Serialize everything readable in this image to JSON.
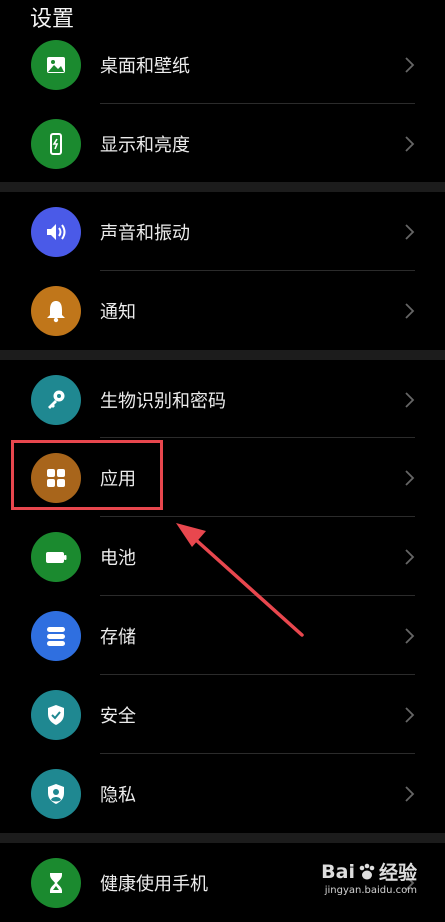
{
  "header": {
    "title": "设置"
  },
  "settings": {
    "items": [
      {
        "label": "桌面和壁纸",
        "icon": "wallpaper-icon",
        "color": "#1b8a2f"
      },
      {
        "label": "显示和亮度",
        "icon": "display-icon",
        "color": "#1b8a2f"
      },
      {
        "label": "声音和振动",
        "icon": "speaker-icon",
        "color": "#4a5ae8"
      },
      {
        "label": "通知",
        "icon": "bell-icon",
        "color": "#c0761a"
      },
      {
        "label": "生物识别和密码",
        "icon": "key-icon",
        "color": "#1f8891"
      },
      {
        "label": "应用",
        "icon": "apps-grid-icon",
        "color": "#a8651b"
      },
      {
        "label": "电池",
        "icon": "battery-icon",
        "color": "#1b8a2f"
      },
      {
        "label": "存储",
        "icon": "storage-icon",
        "color": "#2f6fe0"
      },
      {
        "label": "安全",
        "icon": "shield-check-icon",
        "color": "#1f8891"
      },
      {
        "label": "隐私",
        "icon": "privacy-icon",
        "color": "#1f8891"
      },
      {
        "label": "健康使用手机",
        "icon": "hourglass-icon",
        "color": "#1b8a2f"
      }
    ]
  },
  "annotation": {
    "highlight_color": "#e8474e",
    "highlighted_item": "应用"
  },
  "watermark": {
    "brand": "Bai",
    "brand_suffix": "经验",
    "url": "jingyan.baidu.com"
  }
}
